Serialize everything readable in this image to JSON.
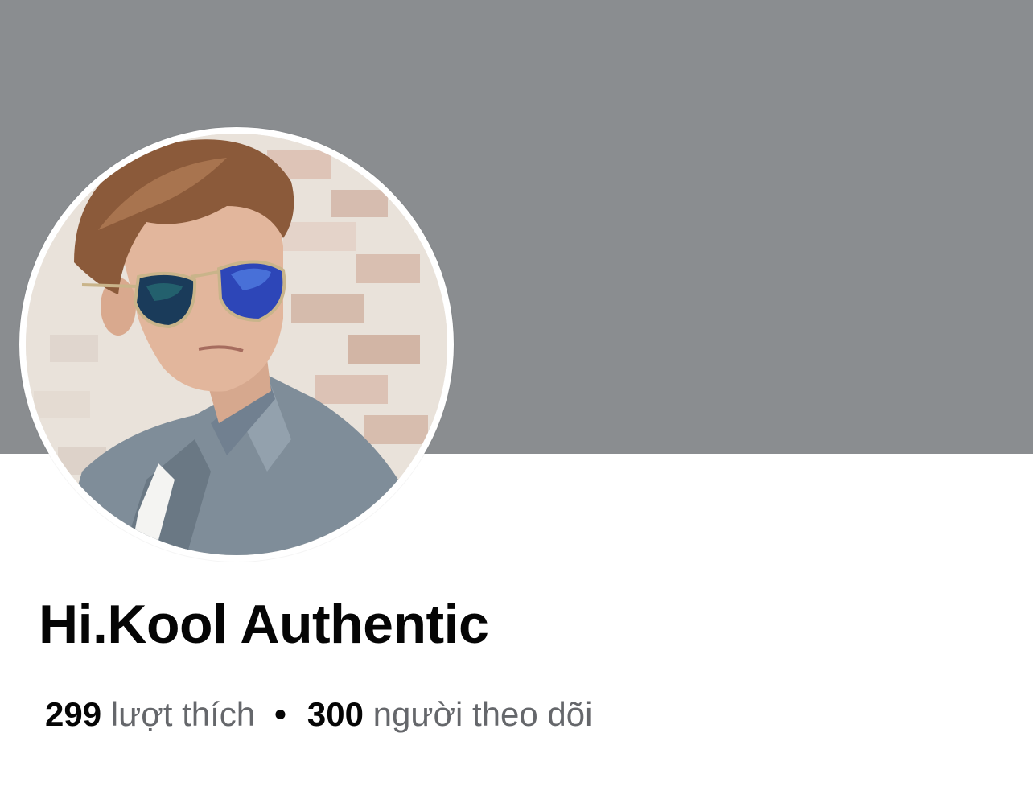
{
  "profile": {
    "name": "Hi.Kool Authentic",
    "likes_count": "299",
    "likes_label": "lượt thích",
    "separator": "•",
    "followers_count": "300",
    "followers_label": "người theo dõi"
  },
  "colors": {
    "cover": "#8a8d90",
    "name_text": "#050505",
    "secondary_text": "#65676b"
  }
}
